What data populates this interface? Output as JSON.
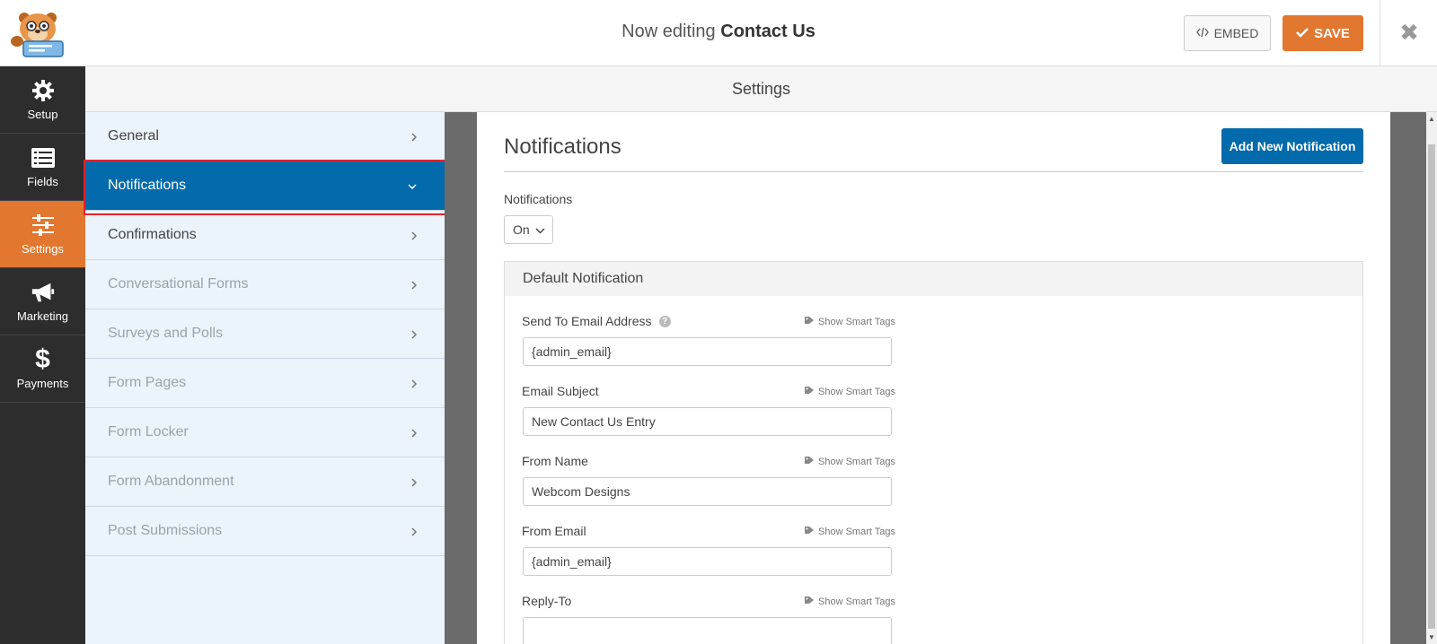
{
  "header": {
    "title_prefix": "Now editing",
    "form_name": "Contact Us",
    "embed_label": "EMBED",
    "save_label": "SAVE"
  },
  "rail": {
    "items": [
      {
        "label": "Setup",
        "icon": "gear-icon"
      },
      {
        "label": "Fields",
        "icon": "list-icon"
      },
      {
        "label": "Settings",
        "icon": "sliders-icon",
        "active": true
      },
      {
        "label": "Marketing",
        "icon": "megaphone-icon"
      },
      {
        "label": "Payments",
        "icon": "dollar-icon"
      }
    ]
  },
  "settings": {
    "header": "Settings",
    "items": [
      {
        "label": "General"
      },
      {
        "label": "Notifications",
        "active": true
      },
      {
        "label": "Confirmations"
      },
      {
        "label": "Conversational Forms",
        "disabled": true
      },
      {
        "label": "Surveys and Polls",
        "disabled": true
      },
      {
        "label": "Form Pages",
        "disabled": true
      },
      {
        "label": "Form Locker",
        "disabled": true
      },
      {
        "label": "Form Abandonment",
        "disabled": true
      },
      {
        "label": "Post Submissions",
        "disabled": true
      }
    ]
  },
  "main": {
    "title": "Notifications",
    "add_button": "Add New Notification",
    "notifications_label": "Notifications",
    "notifications_value": "On",
    "block_title": "Default Notification",
    "smart_tags_label": "Show Smart Tags",
    "fields": [
      {
        "label": "Send To Email Address",
        "value": "{admin_email}",
        "help": true
      },
      {
        "label": "Email Subject",
        "value": "New Contact Us Entry"
      },
      {
        "label": "From Name",
        "value": "Webcom Designs"
      },
      {
        "label": "From Email",
        "value": "{admin_email}"
      },
      {
        "label": "Reply-To",
        "value": ""
      }
    ]
  },
  "colors": {
    "accent": "#e27730",
    "primary": "#036aab",
    "rail": "#2d2d2d",
    "highlight": "#e0232e"
  }
}
